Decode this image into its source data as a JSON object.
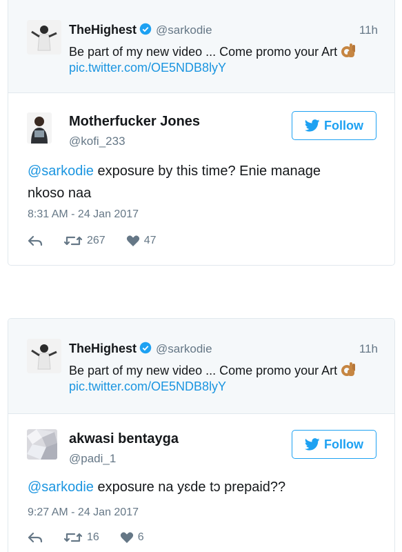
{
  "tweets": [
    {
      "quoted": {
        "name": "TheHighest",
        "handle": "@sarkodie",
        "time": "11h",
        "text": "Be part of my new video ... Come promo your Art",
        "link": "pic.twitter.com/OE5NDB8lyY"
      },
      "reply": {
        "name": "Motherfucker Jones",
        "handle": "@kofi_233",
        "follow_label": "Follow",
        "mention": "@sarkodie",
        "text_line1": " exposure by this time? Enie manage",
        "text_line2": "nkoso naa",
        "timestamp": "8:31 AM - 24 Jan 2017",
        "retweets": "267",
        "likes": "47"
      }
    },
    {
      "quoted": {
        "name": "TheHighest",
        "handle": "@sarkodie",
        "time": "11h",
        "text": "Be part of my new video ... Come promo your Art",
        "link": "pic.twitter.com/OE5NDB8lyY"
      },
      "reply": {
        "name": "akwasi bentayga",
        "handle": "@padi_1",
        "follow_label": "Follow",
        "mention": "@sarkodie",
        "text_line1": " exposure na yɛde tɔ prepaid??",
        "timestamp": "9:27 AM - 24 Jan 2017",
        "retweets": "16",
        "likes": "6"
      }
    }
  ],
  "colors": {
    "link": "#1b95e0",
    "follow": "#1da1f2",
    "muted": "#657786",
    "quoted_bg": "#f5f8fa"
  }
}
